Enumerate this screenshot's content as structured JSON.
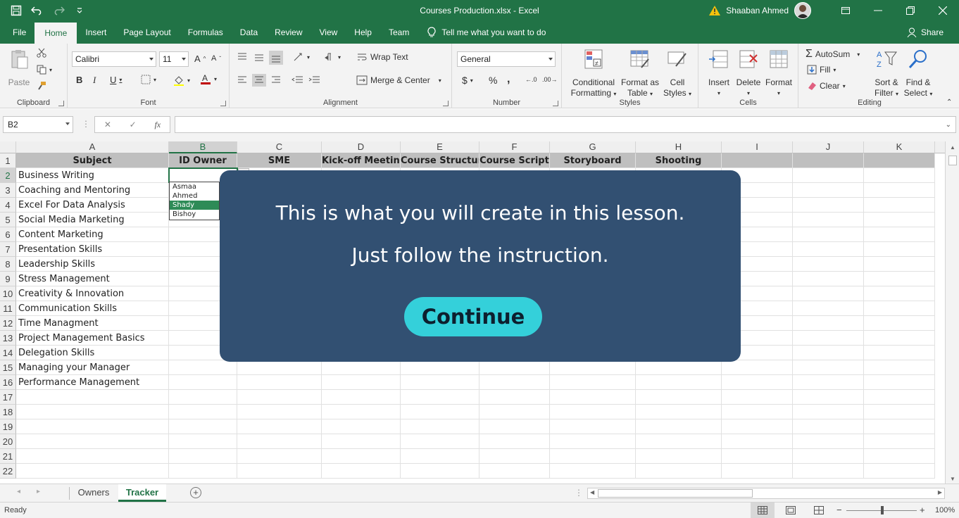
{
  "window": {
    "title": "Courses Production.xlsx  -  Excel",
    "user": "Shaaban Ahmed"
  },
  "tabs": [
    "File",
    "Home",
    "Insert",
    "Page Layout",
    "Formulas",
    "Data",
    "Review",
    "View",
    "Help",
    "Team"
  ],
  "active_tab": "Home",
  "tell_me": "Tell me what you want to do",
  "share": "Share",
  "ribbon": {
    "clipboard": {
      "paste": "Paste",
      "label": "Clipboard"
    },
    "font": {
      "name": "Calibri",
      "size": "11",
      "label": "Font"
    },
    "alignment": {
      "wrap": "Wrap Text",
      "merge": "Merge & Center",
      "label": "Alignment"
    },
    "number": {
      "format": "General",
      "label": "Number"
    },
    "styles": {
      "cond1": "Conditional",
      "cond2": "Formatting",
      "fmt1": "Format as",
      "fmt2": "Table",
      "cell1": "Cell",
      "cell2": "Styles",
      "label": "Styles"
    },
    "cells": {
      "insert": "Insert",
      "delete": "Delete",
      "format": "Format",
      "label": "Cells"
    },
    "editing": {
      "autosum": "AutoSum",
      "fill": "Fill",
      "clear": "Clear",
      "sort1": "Sort &",
      "sort2": "Filter",
      "find1": "Find &",
      "find2": "Select",
      "label": "Editing"
    }
  },
  "formula_bar": {
    "name_box": "B2",
    "formula": ""
  },
  "columns": [
    "A",
    "B",
    "C",
    "D",
    "E",
    "F",
    "G",
    "H",
    "I",
    "J",
    "K"
  ],
  "headers": [
    "Subject",
    "ID Owner",
    "SME",
    "Kick-off Meeting",
    "Course Structure",
    "Course Script",
    "Storyboard",
    "Shooting"
  ],
  "subjects": [
    "Business Writing",
    "Coaching and Mentoring",
    "Excel For Data Analysis",
    "Social Media Marketing",
    "Content Marketing",
    "Presentation Skills",
    "Leadership Skills",
    "Stress Management",
    "Creativity & Innovation",
    "Communication Skills",
    "Time Managment",
    "Project Management Basics",
    "Delegation Skills",
    "Managing your Manager",
    "Performance Management"
  ],
  "row_numbers": [
    "1",
    "2",
    "3",
    "4",
    "5",
    "6",
    "7",
    "8",
    "9",
    "10",
    "11",
    "12",
    "13",
    "14",
    "15",
    "16",
    "17",
    "18",
    "19",
    "20",
    "21",
    "22"
  ],
  "dropdown_options": [
    "Asmaa",
    "Ahmed",
    "Shady",
    "Bishoy"
  ],
  "dropdown_highlight": "Shady",
  "sheets": [
    "Owners",
    "Tracker"
  ],
  "active_sheet": "Tracker",
  "status": {
    "ready": "Ready",
    "zoom": "100%"
  },
  "modal": {
    "line1": "This is what you will create in this lesson.",
    "line2": "Just follow the instruction.",
    "button": "Continue",
    "bg_color": "#325072",
    "button_color": "#34d0da"
  },
  "colors": {
    "excel_green": "#217346"
  }
}
